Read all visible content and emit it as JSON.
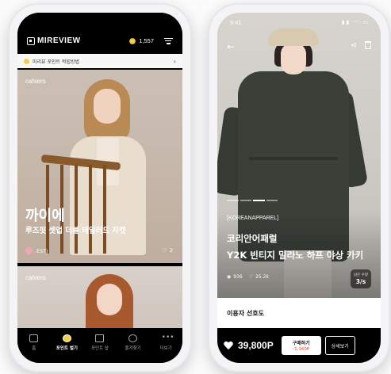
{
  "left_app": {
    "logo_text": "MIREVIEW",
    "points": "1,557",
    "notice": "미리뷰 포인트 적립방법",
    "cards": [
      {
        "brand": "cahiers",
        "title": "까이에",
        "subtitle": "루즈핏 셋업 더블 테일러드 자켓",
        "mbti": "ESTJ",
        "likes": "2"
      },
      {
        "brand": "cahiers"
      }
    ],
    "bottom_nav": [
      {
        "label": "홈",
        "icon": "home-icon",
        "active": false
      },
      {
        "label": "포인트 벌기",
        "icon": "coin-icon",
        "active": true
      },
      {
        "label": "포인트 샵",
        "icon": "shop-icon",
        "active": false
      },
      {
        "label": "즐겨찾기",
        "icon": "face-icon",
        "active": false
      },
      {
        "label": "더보기",
        "icon": "more-icon",
        "active": false
      }
    ]
  },
  "right_app": {
    "status_time": "9:41",
    "brand_tag": "[KOREANAPPAREL]",
    "brand_name": "코리안어패럴",
    "product_name": "Y2K 빈티지 밀라노 하프 야상 카키",
    "views": "936",
    "likes": "25.2k",
    "size_badge_label": "남은 수량",
    "size_badge_value": "3/s",
    "section_title": "이용자 선호도",
    "price": "39,800P",
    "buy_label": "구매하기",
    "buy_discount": "-1,160P",
    "detail_label": "상세보기"
  },
  "colors": {
    "accent_coin": "#f1cf4a",
    "discount_red": "#e8452a",
    "bar_black": "#000000"
  }
}
